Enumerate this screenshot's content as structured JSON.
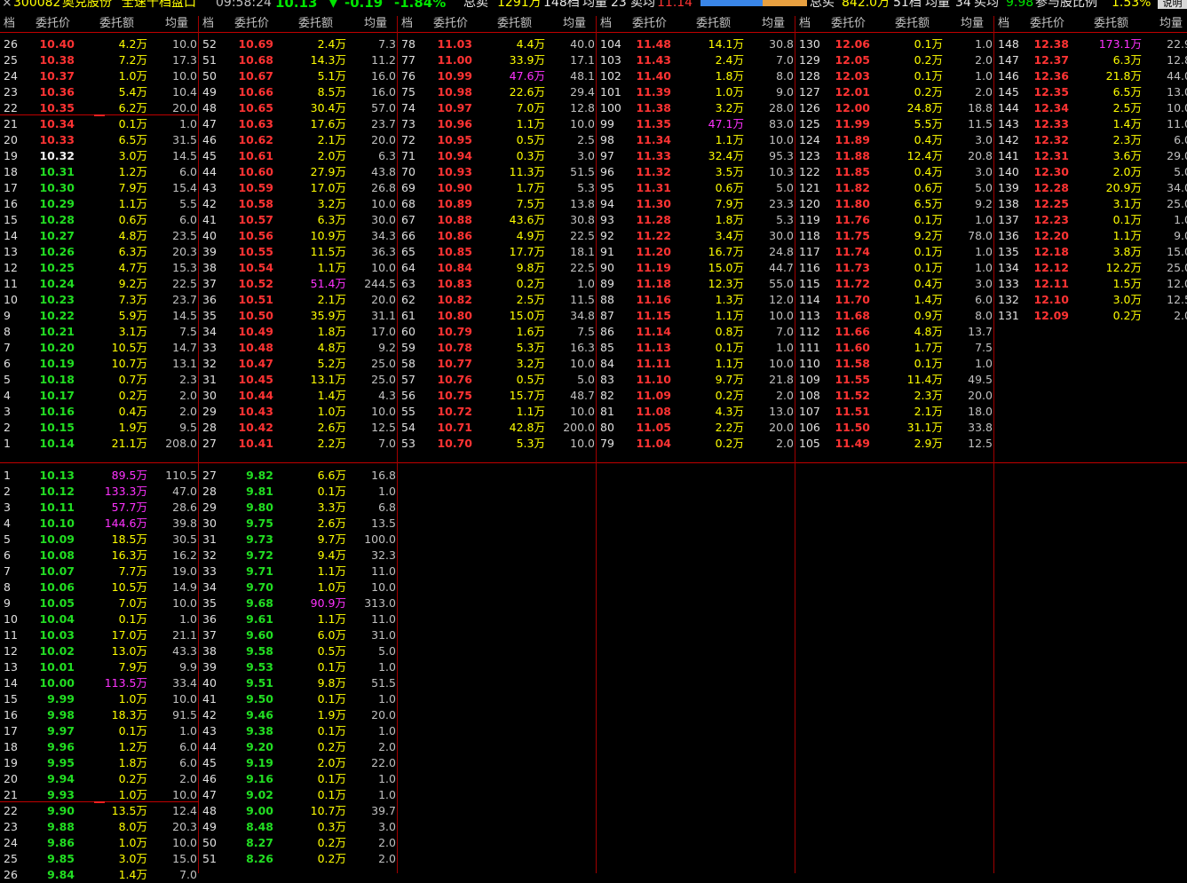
{
  "header": {
    "close_glyph": "×",
    "code": "300082",
    "name": "奥克股份",
    "title": "全速千档盘口",
    "time": "09:58:24",
    "price": "10.13",
    "arrow": "▼",
    "change": "-0.19",
    "pct": "-1.84%",
    "sell_label": "总卖",
    "sell_total": "1291万",
    "sell_levels": "148档",
    "sell_avg_label": "均量",
    "sell_avg": "23",
    "sell_mean_label": "卖均",
    "sell_mean": "11.14",
    "buy_label": "总买",
    "buy_total": "842.0万",
    "buy_levels": "51档",
    "buy_avg_label": "均量",
    "buy_avg": "34",
    "buy_mean_label": "买均",
    "buy_mean": "9.98",
    "ratio_label": "参与股比例",
    "ratio": "1.53%",
    "help_label": "说明",
    "colors": {
      "bar_blue": "#3a86e8",
      "bar_orange": "#e8a040"
    }
  },
  "column_headers": {
    "idx": "档",
    "price": "委托价",
    "amount": "委托额",
    "avg": "均量"
  },
  "colors": {
    "red": "#ff3333",
    "green": "#22dd22",
    "white": "#f0f0f0",
    "yellow": "#ffff00",
    "magenta": "#ff33ff"
  },
  "sell_columns": [
    {
      "start": 26,
      "rows": [
        [
          "26",
          "10.40",
          "4.2万",
          "10.0"
        ],
        [
          "25",
          "10.38",
          "7.2万",
          "17.3"
        ],
        [
          "24",
          "10.37",
          "1.0万",
          "10.0"
        ],
        [
          "23",
          "10.36",
          "5.4万",
          "10.4"
        ],
        [
          "22",
          "10.35",
          "6.2万",
          "20.0"
        ],
        [
          "21",
          "10.34",
          "0.1万",
          "1.0"
        ],
        [
          "20",
          "10.33",
          "6.5万",
          "31.5"
        ],
        [
          "19",
          "10.32",
          "3.0万",
          "14.5"
        ],
        [
          "18",
          "10.31",
          "1.2万",
          "6.0"
        ],
        [
          "17",
          "10.30",
          "7.9万",
          "15.4"
        ],
        [
          "16",
          "10.29",
          "1.1万",
          "5.5"
        ],
        [
          "15",
          "10.28",
          "0.6万",
          "6.0"
        ],
        [
          "14",
          "10.27",
          "4.8万",
          "23.5"
        ],
        [
          "13",
          "10.26",
          "6.3万",
          "20.3"
        ],
        [
          "12",
          "10.25",
          "4.7万",
          "15.3"
        ],
        [
          "11",
          "10.24",
          "9.2万",
          "22.5"
        ],
        [
          "10",
          "10.23",
          "7.3万",
          "23.7"
        ],
        [
          "9",
          "10.22",
          "5.9万",
          "14.5"
        ],
        [
          "8",
          "10.21",
          "3.1万",
          "7.5"
        ],
        [
          "7",
          "10.20",
          "10.5万",
          "14.7"
        ],
        [
          "6",
          "10.19",
          "10.7万",
          "13.1"
        ],
        [
          "5",
          "10.18",
          "0.7万",
          "2.3"
        ],
        [
          "4",
          "10.17",
          "0.2万",
          "2.0"
        ],
        [
          "3",
          "10.16",
          "0.4万",
          "2.0"
        ],
        [
          "2",
          "10.15",
          "1.9万",
          "9.5"
        ],
        [
          "1",
          "10.14",
          "21.1万",
          "208.0"
        ]
      ]
    },
    {
      "start": 52,
      "rows": [
        [
          "52",
          "10.69",
          "2.4万",
          "7.3"
        ],
        [
          "51",
          "10.68",
          "14.3万",
          "11.2"
        ],
        [
          "50",
          "10.67",
          "5.1万",
          "16.0"
        ],
        [
          "49",
          "10.66",
          "8.5万",
          "16.0"
        ],
        [
          "48",
          "10.65",
          "30.4万",
          "57.0"
        ],
        [
          "47",
          "10.63",
          "17.6万",
          "23.7"
        ],
        [
          "46",
          "10.62",
          "2.1万",
          "20.0"
        ],
        [
          "45",
          "10.61",
          "2.0万",
          "6.3"
        ],
        [
          "44",
          "10.60",
          "27.9万",
          "43.8"
        ],
        [
          "43",
          "10.59",
          "17.0万",
          "26.8"
        ],
        [
          "42",
          "10.58",
          "3.2万",
          "10.0"
        ],
        [
          "41",
          "10.57",
          "6.3万",
          "30.0"
        ],
        [
          "40",
          "10.56",
          "10.9万",
          "34.3"
        ],
        [
          "39",
          "10.55",
          "11.5万",
          "36.3"
        ],
        [
          "38",
          "10.54",
          "1.1万",
          "10.0"
        ],
        [
          "37",
          "10.52",
          "51.4万",
          "244.5"
        ],
        [
          "36",
          "10.51",
          "2.1万",
          "20.0"
        ],
        [
          "35",
          "10.50",
          "35.9万",
          "31.1"
        ],
        [
          "34",
          "10.49",
          "1.8万",
          "17.0"
        ],
        [
          "33",
          "10.48",
          "4.8万",
          "9.2"
        ],
        [
          "32",
          "10.47",
          "5.2万",
          "25.0"
        ],
        [
          "31",
          "10.45",
          "13.1万",
          "25.0"
        ],
        [
          "30",
          "10.44",
          "1.4万",
          "4.3"
        ],
        [
          "29",
          "10.43",
          "1.0万",
          "10.0"
        ],
        [
          "28",
          "10.42",
          "2.6万",
          "12.5"
        ],
        [
          "27",
          "10.41",
          "2.2万",
          "7.0"
        ]
      ]
    },
    {
      "start": 78,
      "rows": [
        [
          "78",
          "11.03",
          "4.4万",
          "40.0"
        ],
        [
          "77",
          "11.00",
          "33.9万",
          "17.1"
        ],
        [
          "76",
          "10.99",
          "47.6万",
          "48.1"
        ],
        [
          "75",
          "10.98",
          "22.6万",
          "29.4"
        ],
        [
          "74",
          "10.97",
          "7.0万",
          "12.8"
        ],
        [
          "73",
          "10.96",
          "1.1万",
          "10.0"
        ],
        [
          "72",
          "10.95",
          "0.5万",
          "2.5"
        ],
        [
          "71",
          "10.94",
          "0.3万",
          "3.0"
        ],
        [
          "70",
          "10.93",
          "11.3万",
          "51.5"
        ],
        [
          "69",
          "10.90",
          "1.7万",
          "5.3"
        ],
        [
          "68",
          "10.89",
          "7.5万",
          "13.8"
        ],
        [
          "67",
          "10.88",
          "43.6万",
          "30.8"
        ],
        [
          "66",
          "10.86",
          "4.9万",
          "22.5"
        ],
        [
          "65",
          "10.85",
          "17.7万",
          "18.1"
        ],
        [
          "64",
          "10.84",
          "9.8万",
          "22.5"
        ],
        [
          "63",
          "10.83",
          "0.2万",
          "1.0"
        ],
        [
          "62",
          "10.82",
          "2.5万",
          "11.5"
        ],
        [
          "61",
          "10.80",
          "15.0万",
          "34.8"
        ],
        [
          "60",
          "10.79",
          "1.6万",
          "7.5"
        ],
        [
          "59",
          "10.78",
          "5.3万",
          "16.3"
        ],
        [
          "58",
          "10.77",
          "3.2万",
          "10.0"
        ],
        [
          "57",
          "10.76",
          "0.5万",
          "5.0"
        ],
        [
          "56",
          "10.75",
          "15.7万",
          "48.7"
        ],
        [
          "55",
          "10.72",
          "1.1万",
          "10.0"
        ],
        [
          "54",
          "10.71",
          "42.8万",
          "200.0"
        ],
        [
          "53",
          "10.70",
          "5.3万",
          "10.0"
        ]
      ]
    },
    {
      "start": 104,
      "rows": [
        [
          "104",
          "11.48",
          "14.1万",
          "30.8"
        ],
        [
          "103",
          "11.43",
          "2.4万",
          "7.0"
        ],
        [
          "102",
          "11.40",
          "1.8万",
          "8.0"
        ],
        [
          "101",
          "11.39",
          "1.0万",
          "9.0"
        ],
        [
          "100",
          "11.38",
          "3.2万",
          "28.0"
        ],
        [
          "99",
          "11.35",
          "47.1万",
          "83.0"
        ],
        [
          "98",
          "11.34",
          "1.1万",
          "10.0"
        ],
        [
          "97",
          "11.33",
          "32.4万",
          "95.3"
        ],
        [
          "96",
          "11.32",
          "3.5万",
          "10.3"
        ],
        [
          "95",
          "11.31",
          "0.6万",
          "5.0"
        ],
        [
          "94",
          "11.30",
          "7.9万",
          "23.3"
        ],
        [
          "93",
          "11.28",
          "1.8万",
          "5.3"
        ],
        [
          "92",
          "11.22",
          "3.4万",
          "30.0"
        ],
        [
          "91",
          "11.20",
          "16.7万",
          "24.8"
        ],
        [
          "90",
          "11.19",
          "15.0万",
          "44.7"
        ],
        [
          "89",
          "11.18",
          "12.3万",
          "55.0"
        ],
        [
          "88",
          "11.16",
          "1.3万",
          "12.0"
        ],
        [
          "87",
          "11.15",
          "1.1万",
          "10.0"
        ],
        [
          "86",
          "11.14",
          "0.8万",
          "7.0"
        ],
        [
          "85",
          "11.13",
          "0.1万",
          "1.0"
        ],
        [
          "84",
          "11.11",
          "1.1万",
          "10.0"
        ],
        [
          "83",
          "11.10",
          "9.7万",
          "21.8"
        ],
        [
          "82",
          "11.09",
          "0.2万",
          "2.0"
        ],
        [
          "81",
          "11.08",
          "4.3万",
          "13.0"
        ],
        [
          "80",
          "11.05",
          "2.2万",
          "20.0"
        ],
        [
          "79",
          "11.04",
          "0.2万",
          "2.0"
        ]
      ]
    },
    {
      "start": 130,
      "rows": [
        [
          "130",
          "12.06",
          "0.1万",
          "1.0"
        ],
        [
          "129",
          "12.05",
          "0.2万",
          "2.0"
        ],
        [
          "128",
          "12.03",
          "0.1万",
          "1.0"
        ],
        [
          "127",
          "12.01",
          "0.2万",
          "2.0"
        ],
        [
          "126",
          "12.00",
          "24.8万",
          "18.8"
        ],
        [
          "125",
          "11.99",
          "5.5万",
          "11.5"
        ],
        [
          "124",
          "11.89",
          "0.4万",
          "3.0"
        ],
        [
          "123",
          "11.88",
          "12.4万",
          "20.8"
        ],
        [
          "122",
          "11.85",
          "0.4万",
          "3.0"
        ],
        [
          "121",
          "11.82",
          "0.6万",
          "5.0"
        ],
        [
          "120",
          "11.80",
          "6.5万",
          "9.2"
        ],
        [
          "119",
          "11.76",
          "0.1万",
          "1.0"
        ],
        [
          "118",
          "11.75",
          "9.2万",
          "78.0"
        ],
        [
          "117",
          "11.74",
          "0.1万",
          "1.0"
        ],
        [
          "116",
          "11.73",
          "0.1万",
          "1.0"
        ],
        [
          "115",
          "11.72",
          "0.4万",
          "3.0"
        ],
        [
          "114",
          "11.70",
          "1.4万",
          "6.0"
        ],
        [
          "113",
          "11.68",
          "0.9万",
          "8.0"
        ],
        [
          "112",
          "11.66",
          "4.8万",
          "13.7"
        ],
        [
          "111",
          "11.60",
          "1.7万",
          "7.5"
        ],
        [
          "110",
          "11.58",
          "0.1万",
          "1.0"
        ],
        [
          "109",
          "11.55",
          "11.4万",
          "49.5"
        ],
        [
          "108",
          "11.52",
          "2.3万",
          "20.0"
        ],
        [
          "107",
          "11.51",
          "2.1万",
          "18.0"
        ],
        [
          "106",
          "11.50",
          "31.1万",
          "33.8"
        ],
        [
          "105",
          "11.49",
          "2.9万",
          "12.5"
        ]
      ]
    },
    {
      "start": 148,
      "rows": [
        [
          "148",
          "12.38",
          "173.1万",
          "22.9"
        ],
        [
          "147",
          "12.37",
          "6.3万",
          "12.8"
        ],
        [
          "146",
          "12.36",
          "21.8万",
          "44.0"
        ],
        [
          "145",
          "12.35",
          "6.5万",
          "13.0"
        ],
        [
          "144",
          "12.34",
          "2.5万",
          "10.0"
        ],
        [
          "143",
          "12.33",
          "1.4万",
          "11.0"
        ],
        [
          "142",
          "12.32",
          "2.3万",
          "6.0"
        ],
        [
          "141",
          "12.31",
          "3.6万",
          "29.0"
        ],
        [
          "140",
          "12.30",
          "2.0万",
          "5.0"
        ],
        [
          "139",
          "12.28",
          "20.9万",
          "34.0"
        ],
        [
          "138",
          "12.25",
          "3.1万",
          "25.0"
        ],
        [
          "137",
          "12.23",
          "0.1万",
          "1.0"
        ],
        [
          "136",
          "12.20",
          "1.1万",
          "9.0"
        ],
        [
          "135",
          "12.18",
          "3.8万",
          "15.0"
        ],
        [
          "134",
          "12.12",
          "12.2万",
          "25.0"
        ],
        [
          "133",
          "12.11",
          "1.5万",
          "12.0"
        ],
        [
          "132",
          "12.10",
          "3.0万",
          "12.5"
        ],
        [
          "131",
          "12.09",
          "0.2万",
          "2.0"
        ]
      ]
    }
  ],
  "buy_columns": [
    {
      "rows": [
        [
          "1",
          "10.13",
          "89.5万",
          "110.5"
        ],
        [
          "2",
          "10.12",
          "133.3万",
          "47.0"
        ],
        [
          "3",
          "10.11",
          "57.7万",
          "28.6"
        ],
        [
          "4",
          "10.10",
          "144.6万",
          "39.8"
        ],
        [
          "5",
          "10.09",
          "18.5万",
          "30.5"
        ],
        [
          "6",
          "10.08",
          "16.3万",
          "16.2"
        ],
        [
          "7",
          "10.07",
          "7.7万",
          "19.0"
        ],
        [
          "8",
          "10.06",
          "10.5万",
          "14.9"
        ],
        [
          "9",
          "10.05",
          "7.0万",
          "10.0"
        ],
        [
          "10",
          "10.04",
          "0.1万",
          "1.0"
        ],
        [
          "11",
          "10.03",
          "17.0万",
          "21.1"
        ],
        [
          "12",
          "10.02",
          "13.0万",
          "43.3"
        ],
        [
          "13",
          "10.01",
          "7.9万",
          "9.9"
        ],
        [
          "14",
          "10.00",
          "113.5万",
          "33.4"
        ],
        [
          "15",
          "9.99",
          "1.0万",
          "10.0"
        ],
        [
          "16",
          "9.98",
          "18.3万",
          "91.5"
        ],
        [
          "17",
          "9.97",
          "0.1万",
          "1.0"
        ],
        [
          "18",
          "9.96",
          "1.2万",
          "6.0"
        ],
        [
          "19",
          "9.95",
          "1.8万",
          "6.0"
        ],
        [
          "20",
          "9.94",
          "0.2万",
          "2.0"
        ],
        [
          "21",
          "9.93",
          "1.0万",
          "10.0"
        ],
        [
          "22",
          "9.90",
          "13.5万",
          "12.4"
        ],
        [
          "23",
          "9.88",
          "8.0万",
          "20.3"
        ],
        [
          "24",
          "9.86",
          "1.0万",
          "10.0"
        ],
        [
          "25",
          "9.85",
          "3.0万",
          "15.0"
        ],
        [
          "26",
          "9.84",
          "1.4万",
          "7.0"
        ]
      ]
    },
    {
      "rows": [
        [
          "27",
          "9.82",
          "6.6万",
          "16.8"
        ],
        [
          "28",
          "9.81",
          "0.1万",
          "1.0"
        ],
        [
          "29",
          "9.80",
          "3.3万",
          "6.8"
        ],
        [
          "30",
          "9.75",
          "2.6万",
          "13.5"
        ],
        [
          "31",
          "9.73",
          "9.7万",
          "100.0"
        ],
        [
          "32",
          "9.72",
          "9.4万",
          "32.3"
        ],
        [
          "33",
          "9.71",
          "1.1万",
          "11.0"
        ],
        [
          "34",
          "9.70",
          "1.0万",
          "10.0"
        ],
        [
          "35",
          "9.68",
          "90.9万",
          "313.0"
        ],
        [
          "36",
          "9.61",
          "1.1万",
          "11.0"
        ],
        [
          "37",
          "9.60",
          "6.0万",
          "31.0"
        ],
        [
          "38",
          "9.58",
          "0.5万",
          "5.0"
        ],
        [
          "39",
          "9.53",
          "0.1万",
          "1.0"
        ],
        [
          "40",
          "9.51",
          "9.8万",
          "51.5"
        ],
        [
          "41",
          "9.50",
          "0.1万",
          "1.0"
        ],
        [
          "42",
          "9.46",
          "1.9万",
          "20.0"
        ],
        [
          "43",
          "9.38",
          "0.1万",
          "1.0"
        ],
        [
          "44",
          "9.20",
          "0.2万",
          "2.0"
        ],
        [
          "45",
          "9.19",
          "2.0万",
          "22.0"
        ],
        [
          "46",
          "9.16",
          "0.1万",
          "1.0"
        ],
        [
          "47",
          "9.02",
          "0.1万",
          "1.0"
        ],
        [
          "48",
          "9.00",
          "10.7万",
          "39.7"
        ],
        [
          "49",
          "8.48",
          "0.3万",
          "3.0"
        ],
        [
          "50",
          "8.27",
          "0.2万",
          "2.0"
        ],
        [
          "51",
          "8.26",
          "0.2万",
          "2.0"
        ]
      ]
    }
  ]
}
